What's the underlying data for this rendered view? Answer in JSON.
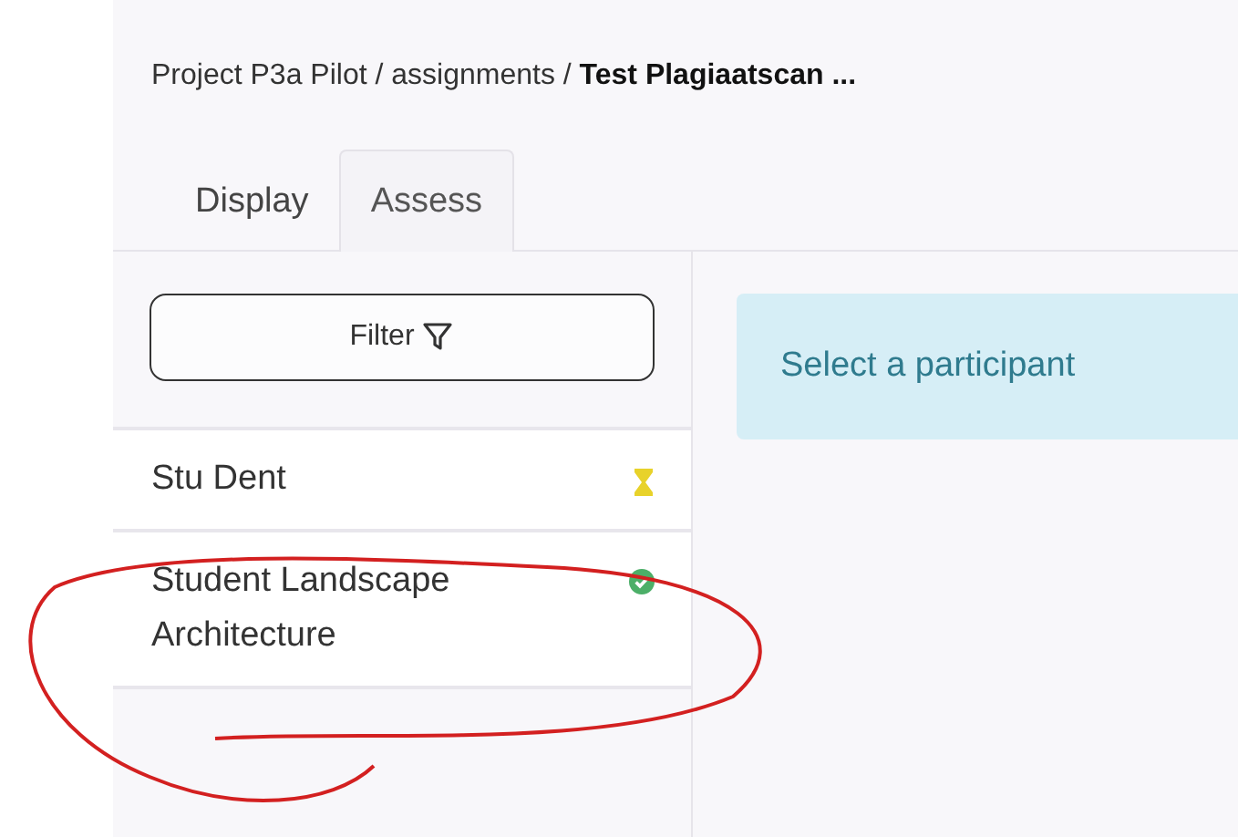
{
  "breadcrumb": {
    "path": "Project P3a Pilot / assignments / ",
    "current": "Test Plagiaatscan ..."
  },
  "tabs": [
    {
      "label": "Display",
      "selected": false
    },
    {
      "label": "Assess",
      "selected": true
    }
  ],
  "filter_button": {
    "label": "Filter"
  },
  "participants": [
    {
      "name": "Stu Dent",
      "kind": "pending"
    },
    {
      "name": "Student Landscape Architecture",
      "kind": "done"
    }
  ],
  "info_box": {
    "text": "Select a participant"
  },
  "annotation": {
    "kind": "ellipse"
  }
}
